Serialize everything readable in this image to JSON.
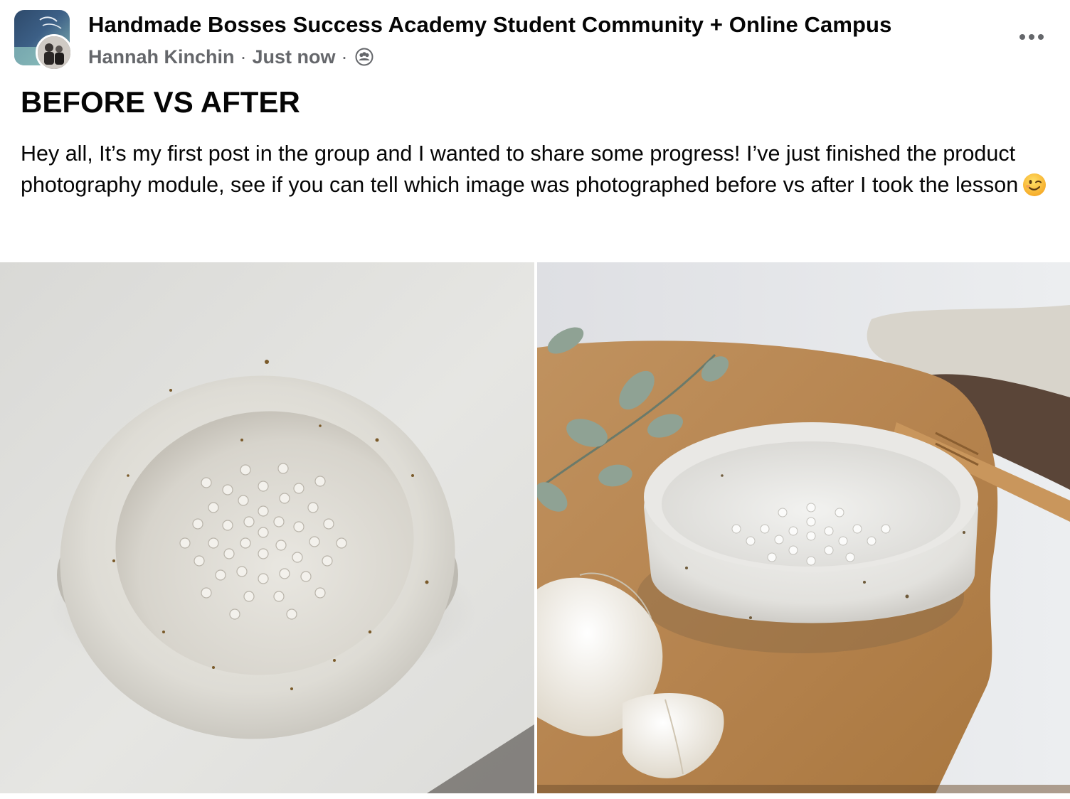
{
  "post": {
    "group_name": "Handmade Bosses Success Academy Student Community + Online Campus",
    "author": "Hannah Kinchin",
    "separator": "·",
    "timestamp": "Just now",
    "audience_icon": "group-audience-icon",
    "more_icon": "more-options-icon",
    "title": "BEFORE VS AFTER",
    "body": "Hey all, It’s my first post in the group and I wanted to share some progress! I’ve just finished the product photography module, see if you can tell which image was photographed before vs after I took the lesson",
    "emoji": "winking-face-emoji"
  },
  "photos": [
    {
      "id": "before",
      "description_icon": "ceramic-grater-dish-photo-plain"
    },
    {
      "id": "after",
      "description_icon": "ceramic-grater-dish-photo-styled"
    }
  ],
  "colors": {
    "text_primary": "#050505",
    "text_secondary": "#65676b",
    "background": "#ffffff"
  }
}
